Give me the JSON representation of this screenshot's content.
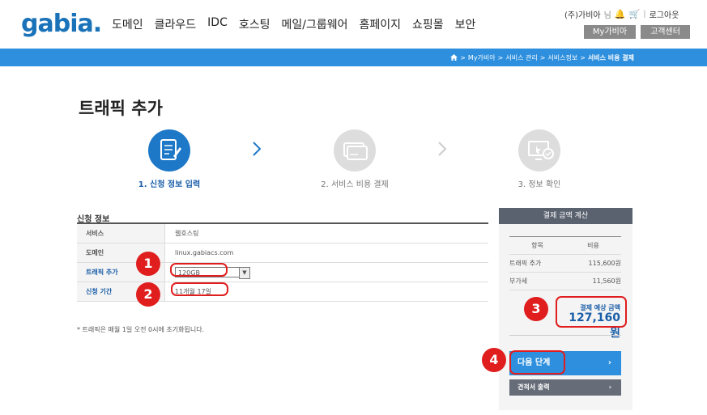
{
  "header": {
    "logo_text": "gabia.",
    "nav": [
      "도메인",
      "클라우드",
      "IDC",
      "호스팅",
      "메일/그룹웨어",
      "홈페이지",
      "쇼핑몰",
      "보안"
    ],
    "user_name": "(주)가비아",
    "user_suffix": "님",
    "logout": "로그아웃",
    "my_gabia": "My가비아",
    "customer_center": "고객센터"
  },
  "breadcrumb": {
    "items": [
      "My가비아",
      "서비스 관리",
      "서비스정보"
    ],
    "current": "서비스 비용 결제",
    "separator": ">"
  },
  "page_title": "트래픽 추가",
  "steps": [
    {
      "label": "1. 신청 정보 입력",
      "active": true
    },
    {
      "label": "2. 서비스 비용 결제",
      "active": false
    },
    {
      "label": "3. 정보 확인",
      "active": false
    }
  ],
  "form": {
    "title": "신청 정보",
    "rows": {
      "service": {
        "label": "서비스",
        "value": "웹호스팅"
      },
      "domain": {
        "label": "도메인",
        "value": "linux.gabiacs.com"
      },
      "traffic": {
        "label": "트래픽 추가",
        "value": "120GB"
      },
      "period": {
        "label": "신청 기간",
        "value": "11개월 17일"
      }
    },
    "note": "* 트래픽은 매월 1일 오전 0시에 초기화됩니다."
  },
  "summary": {
    "title": "결제 금액 계산",
    "col_item": "항목",
    "col_cost": "비용",
    "items": [
      {
        "name": "트래픽 추가",
        "cost": "115,600원"
      },
      {
        "name": "부가세",
        "cost": "11,560원"
      }
    ],
    "total_label": "결제 예상 금액",
    "total_value": "127,160원",
    "next_button": "다음 단계",
    "print_button": "견적서 출력"
  },
  "annotations": [
    "1",
    "2",
    "3",
    "4"
  ],
  "colors": {
    "brand_blue": "#2d8fdd",
    "annotation_red": "#e01e1e",
    "panel_head": "#5a6270"
  }
}
